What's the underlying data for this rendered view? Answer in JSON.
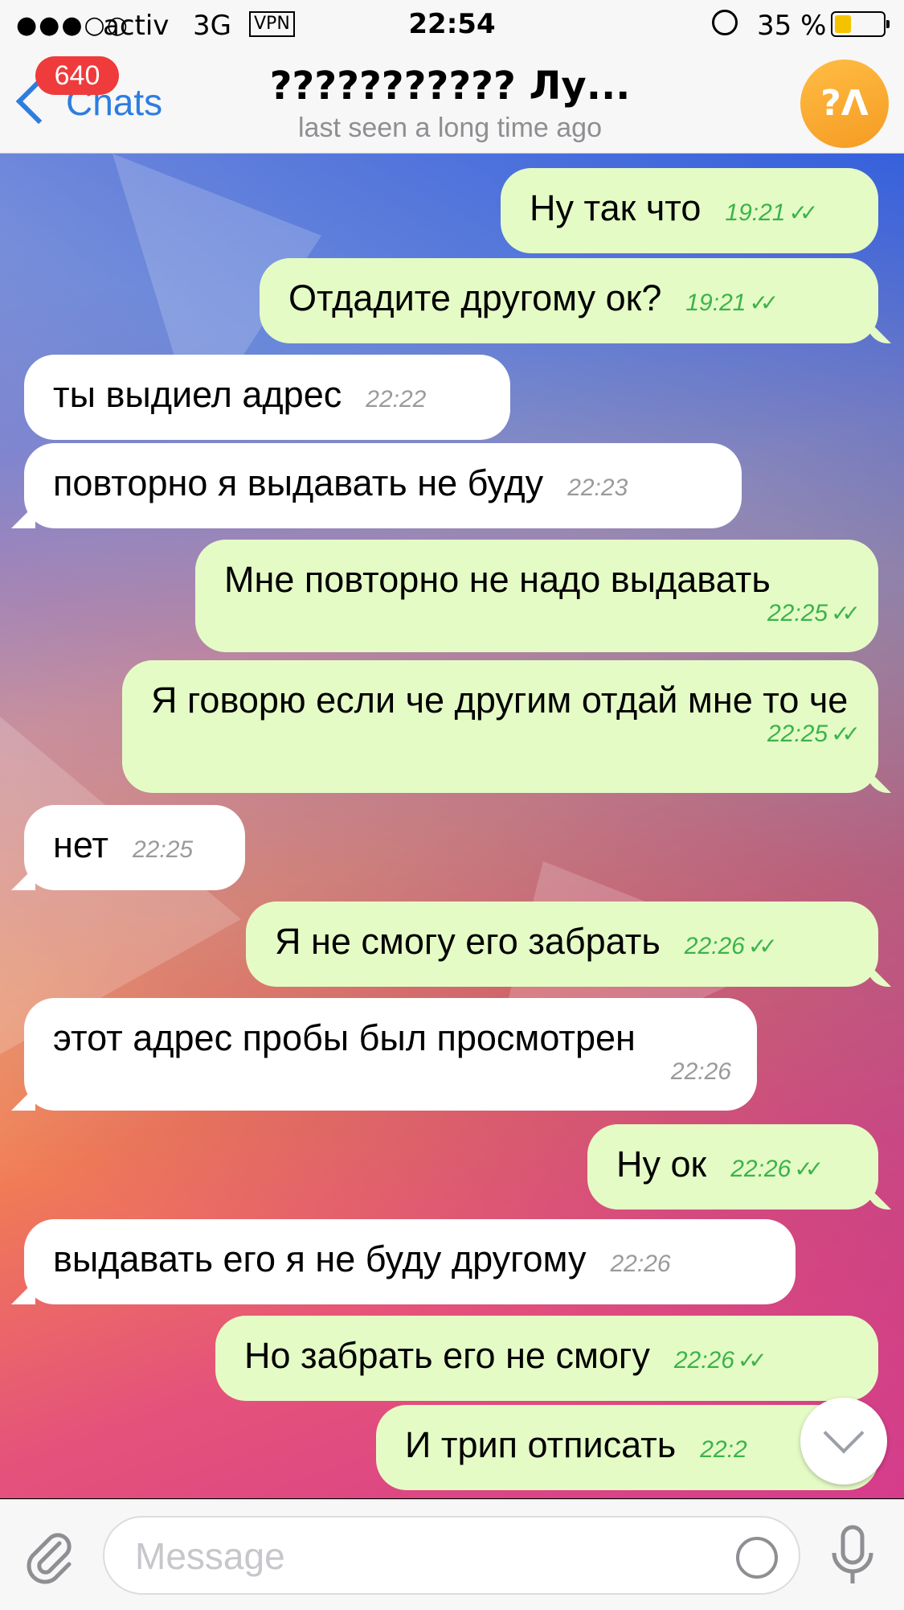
{
  "status_bar": {
    "signal": "●●●○○",
    "carrier": "activ",
    "network": "3G",
    "vpn": "VPN",
    "time": "22:54",
    "battery_percent": "35 %",
    "battery_level": 0.35
  },
  "nav": {
    "back_label": "Chats",
    "unread_badge": "640",
    "title": "??????????? Лу...",
    "subtitle": "last seen a long time ago",
    "avatar_text": "?Λ",
    "avatar_color": "#f7a62f"
  },
  "messages": [
    {
      "dir": "out",
      "text": "Ну так что",
      "time": "19:21",
      "read": true
    },
    {
      "dir": "out",
      "text": "Отдадите другому ок?",
      "time": "19:21",
      "read": true
    },
    {
      "dir": "in",
      "text": "ты выдиел адрес",
      "time": "22:22"
    },
    {
      "dir": "in",
      "text": "повторно я выдавать не буду",
      "time": "22:23"
    },
    {
      "dir": "out",
      "text": "Мне повторно не надо выдавать",
      "time": "22:25",
      "read": true
    },
    {
      "dir": "out",
      "text": "Я говорю если че другим отдай мне то че",
      "time": "22:25",
      "read": true
    },
    {
      "dir": "in",
      "text": "нет",
      "time": "22:25"
    },
    {
      "dir": "out",
      "text": "Я не смогу его забрать",
      "time": "22:26",
      "read": true
    },
    {
      "dir": "in",
      "text": "этот адрес пробы был просмотрен",
      "time": "22:26"
    },
    {
      "dir": "out",
      "text": "Ну ок",
      "time": "22:26",
      "read": true
    },
    {
      "dir": "in",
      "text": "выдавать его я не буду другому",
      "time": "22:26"
    },
    {
      "dir": "out",
      "text": "Но забрать его не смогу",
      "time": "22:26",
      "read": true
    },
    {
      "dir": "out",
      "text": "И трип отписать",
      "time": "22:2",
      "read": false
    }
  ],
  "input": {
    "placeholder": "Message"
  },
  "colors": {
    "accent": "#2d7de0",
    "outgoing_bubble": "#e5fbc6",
    "incoming_bubble": "#ffffff",
    "badge": "#ef3b3b",
    "read_check": "#3bb34a"
  },
  "icons": {
    "back": "chevron-left-icon",
    "attach": "paperclip-icon",
    "sticker": "sticker-icon",
    "mic": "microphone-icon",
    "scroll": "chevron-down-icon"
  }
}
